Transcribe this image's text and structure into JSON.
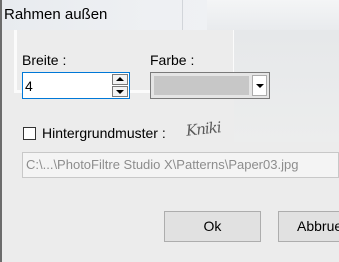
{
  "dialog": {
    "title": "Rahmen außen"
  },
  "width_field": {
    "label": "Breite :",
    "value": "4"
  },
  "color_field": {
    "label": "Farbe :",
    "swatch_color": "#c7c7c7"
  },
  "pattern": {
    "checkbox_label": "Hintergrundmuster :",
    "checked": false,
    "path": "C:\\...\\PhotoFiltre Studio X\\Patterns\\Paper03.jpg",
    "signature_text": "Kniki"
  },
  "buttons": {
    "ok_label": "Ok",
    "cancel_label": "Abbrue"
  },
  "colors": {
    "focus_border": "#0078d7",
    "dialog_background": "#ececec",
    "disabled_text": "#8d8d8d"
  }
}
